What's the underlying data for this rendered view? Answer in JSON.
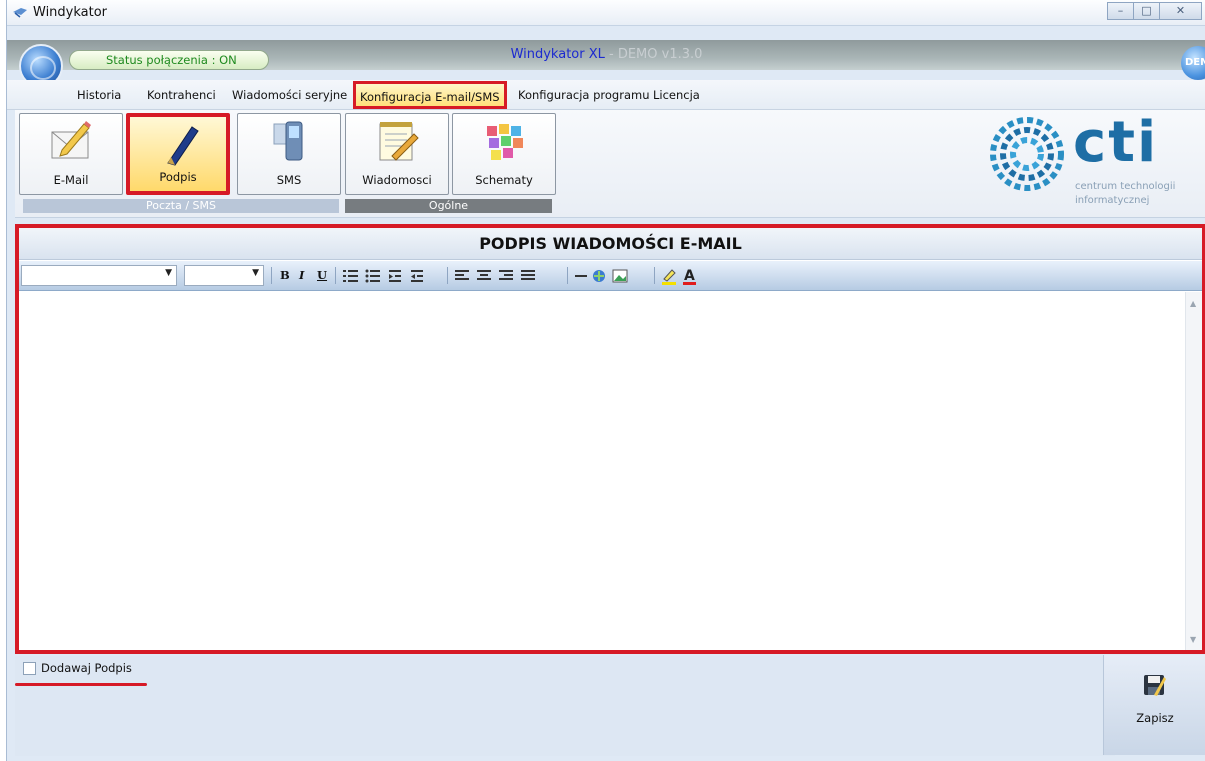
{
  "window": {
    "title": "Windykator"
  },
  "header": {
    "status": "Status połączenia : ON",
    "app_brand": "Windykator XL",
    "app_version": " - DEMO v1.3.0",
    "demo_badge": "DEMO"
  },
  "menu": {
    "items": [
      "Historia",
      "Kontrahenci",
      "Wiadomości seryjne",
      "Konfiguracja E-mail/SMS",
      "Konfiguracja programu",
      "Licencja"
    ],
    "selected": "Konfiguracja E-mail/SMS"
  },
  "ribbon": {
    "buttons": [
      "E-Mail",
      "Podpis",
      "SMS",
      "Wiadomosci",
      "Schematy"
    ],
    "selected": "Podpis",
    "groups": [
      "Poczta / SMS",
      "Ogólne"
    ]
  },
  "logo": {
    "word": "cti",
    "sub1": "centrum technologii",
    "sub2": "informatycznej"
  },
  "editor": {
    "title": "PODPIS WIADOMOŚCI E-MAIL",
    "toolbar": {
      "bold": "B",
      "italic": "I",
      "underline": "U"
    }
  },
  "footer": {
    "checkbox_label": "Dodawaj Podpis",
    "checkbox_checked": false,
    "save_label": "Zapisz"
  },
  "colors": {
    "highlight": "#d61a26",
    "brand_blue": "#1e6ea5"
  }
}
